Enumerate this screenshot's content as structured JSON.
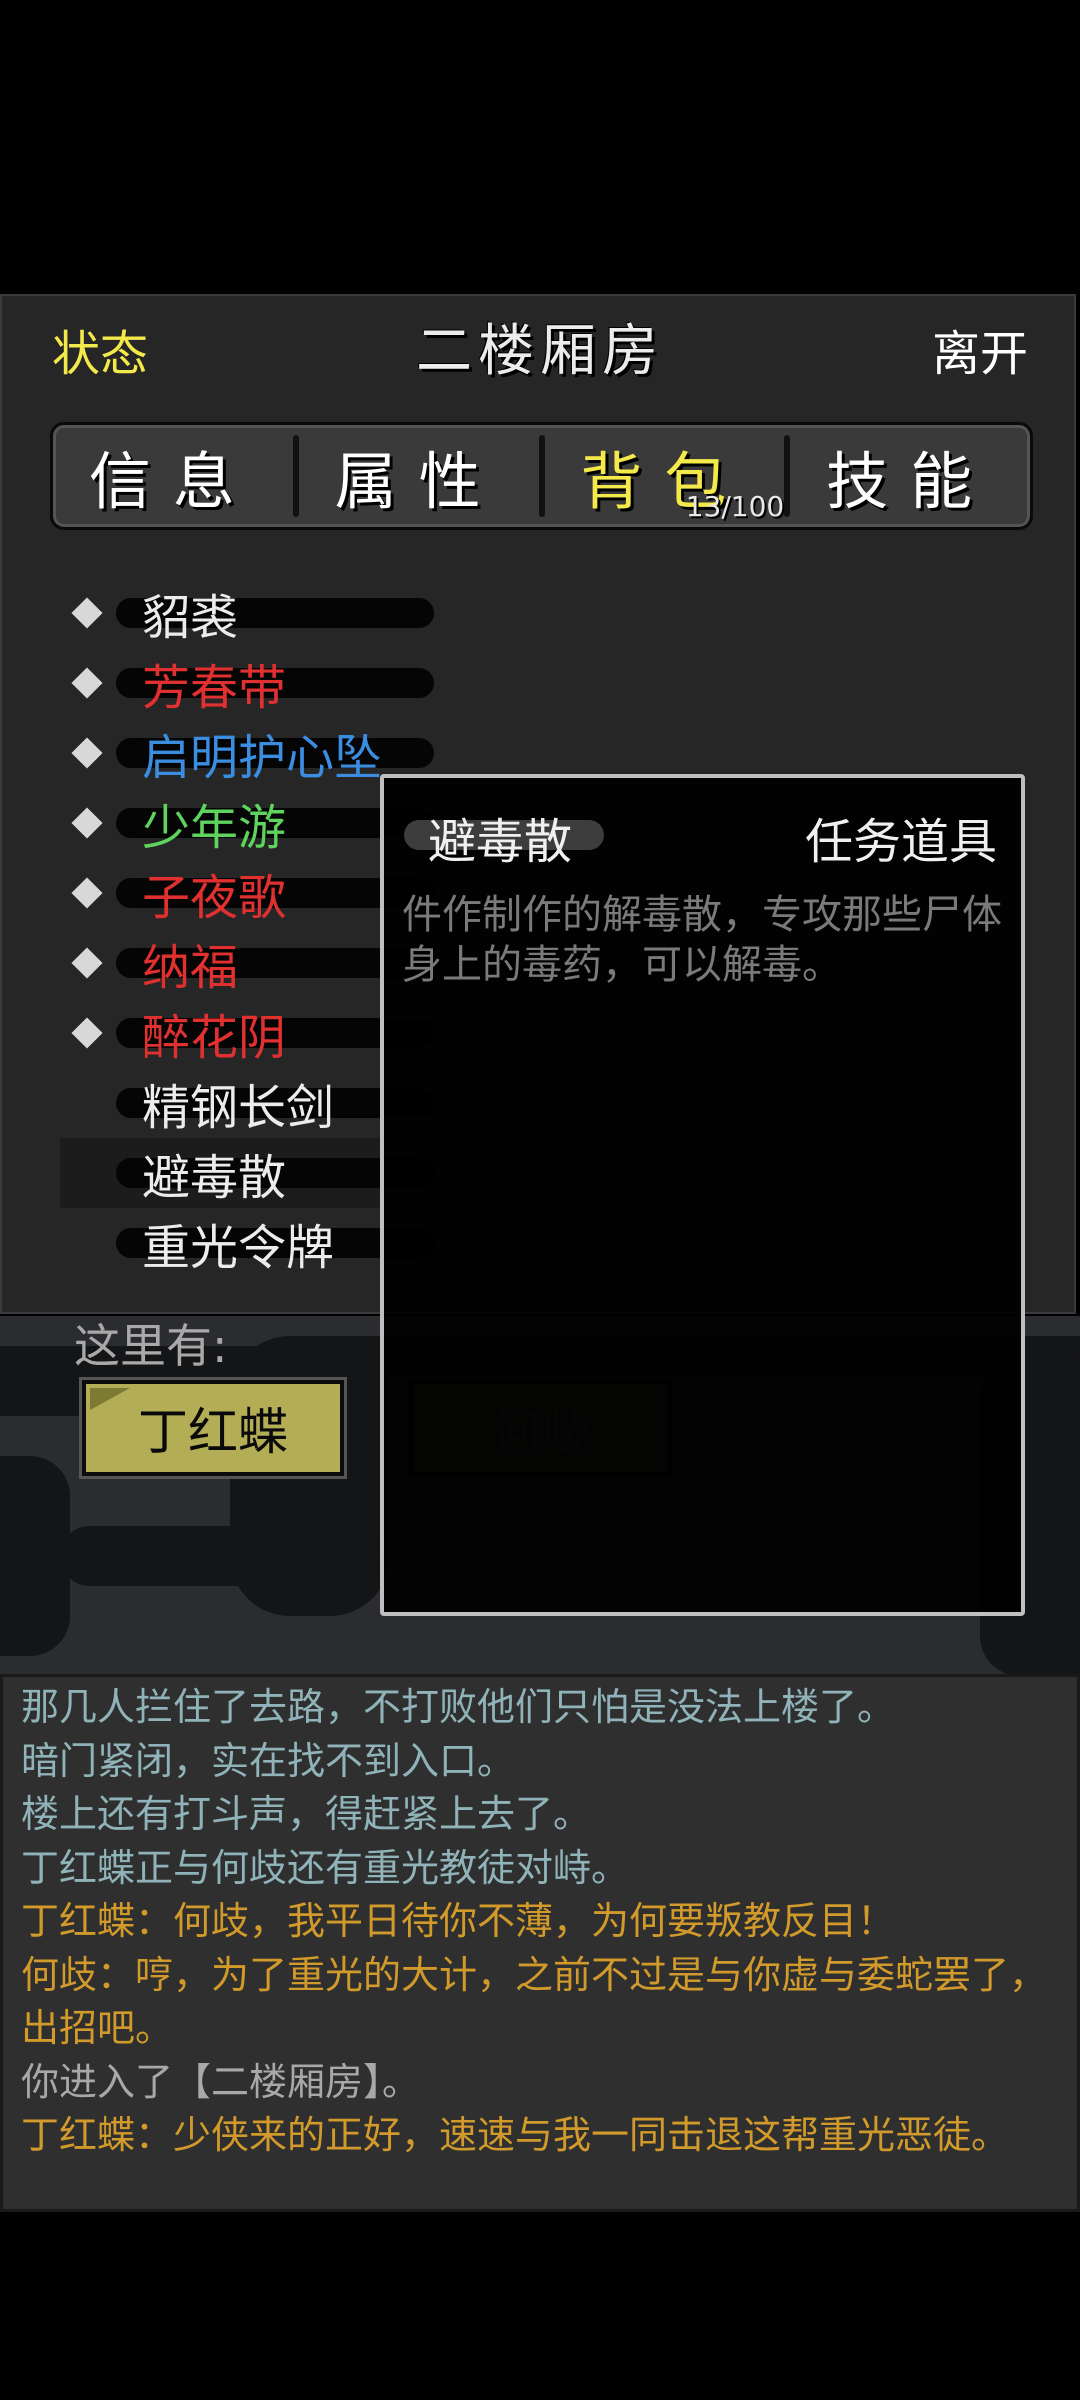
{
  "header": {
    "status_label": "状态",
    "room_title": "二楼厢房",
    "leave_label": "离开"
  },
  "tabs": [
    {
      "label": "信息",
      "active": false
    },
    {
      "label": "属性",
      "active": false
    },
    {
      "label": "背包",
      "active": true,
      "count": "13/100"
    },
    {
      "label": "技能",
      "active": false
    }
  ],
  "inventory": [
    {
      "name": "貂裘",
      "color": "#ececec",
      "marked": true
    },
    {
      "name": "芳春带",
      "color": "#e03030",
      "marked": true
    },
    {
      "name": "启明护心坠",
      "color": "#3b8de0",
      "marked": true
    },
    {
      "name": "少年游",
      "color": "#5ed35e",
      "marked": true
    },
    {
      "name": "子夜歌",
      "color": "#e03030",
      "marked": true
    },
    {
      "name": "纳福",
      "color": "#e03030",
      "marked": true
    },
    {
      "name": "醉花阴",
      "color": "#e03030",
      "marked": true
    },
    {
      "name": "精钢长剑",
      "color": "#ececec",
      "marked": false
    },
    {
      "name": "避毒散",
      "color": "#ececec",
      "marked": false,
      "selected": true
    },
    {
      "name": "重光令牌",
      "color": "#ececec",
      "marked": false
    }
  ],
  "here": {
    "label": "这里有:",
    "npcs": [
      {
        "name": "丁红蝶",
        "dimmed": false
      },
      {
        "name": "何歧",
        "dimmed": true
      }
    ]
  },
  "tooltip": {
    "item_name": "避毒散",
    "item_type": "任务道具",
    "description": "件作制作的解毒散，专攻那些尸体身上的毒药，可以解毒。"
  },
  "log": [
    {
      "text": "那几人拦住了去路，不打败他们只怕是没法上楼了。",
      "color": "#8fb3b8"
    },
    {
      "text": "暗门紧闭，实在找不到入口。",
      "color": "#8fb3b8"
    },
    {
      "text": "楼上还有打斗声，得赶紧上去了。",
      "color": "#8fb3b8"
    },
    {
      "text": "丁红蝶正与何歧还有重光教徒对峙。",
      "color": "#8fb3b8"
    },
    {
      "text": "丁红蝶：何歧，我平日待你不薄，为何要叛教反目！",
      "color": "#d19a2a"
    },
    {
      "text": "何歧：哼，为了重光的大计，之前不过是与你虚与委蛇罢了，出招吧。",
      "color": "#d19a2a"
    },
    {
      "text": "你进入了【二楼厢房】。",
      "color": "#a8a8a8"
    },
    {
      "text": "丁红蝶：少侠来的正好，速速与我一同击退这帮重光恶徒。",
      "color": "#d19a2a"
    }
  ]
}
